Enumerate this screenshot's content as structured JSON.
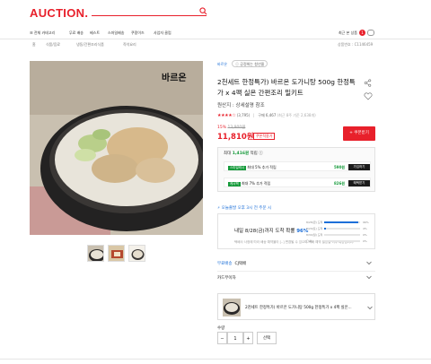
{
  "header": {
    "logo": "AUCTION.",
    "nav": [
      "전체 카테고리",
      "무료 배송",
      "베스트",
      "스마일배송",
      "쿠팡이즈",
      "사업자 클럽"
    ],
    "right_link": "최근 본 상품",
    "cart_count": "1"
  },
  "breadcrumb": [
    "홈",
    "식품/음료",
    "냉동/간편조리식품",
    "즉석요리"
  ],
  "product_no": "상품번호 : C1146459",
  "product": {
    "shop_name": "바르온",
    "shop_tag": "ⓘ 공정위는 청년몰",
    "title": "2천세트 한정특가) 바르온 도가니탕 500g 한정특가 x 4팩 실온 간편조리 밀키트",
    "origin": "원산지 : 상세설명 참조",
    "stars": "★★★★☆",
    "review_count": "(3,795)",
    "purchase": "구매 6,467",
    "purchase_sub": "(최근 8주 기준 2,638개)",
    "discount_rate": "15%",
    "original_price": "13,900원",
    "price": "11,810원",
    "coupon_tag": "쿠폰적용가",
    "coupon_button": "+ 쿠폰받기"
  },
  "benefits": {
    "head_prefix": "최대",
    "head_points": "1,416원",
    "head_suffix": "적립 ⓘ",
    "rows": [
      {
        "badge": "스마일캐시",
        "label": "최대 5% 추가 적립",
        "points": "590원",
        "button": "가입하기"
      },
      {
        "badge": "캐시백",
        "label": "최대 7% 추가 적립",
        "points": "826원",
        "button": "혜택받기"
      }
    ]
  },
  "shipping": {
    "head": "⚡ 오늘출발 오후 3시 전 주문 시",
    "main_prefix": "내일 8/28(금)까지 도착 확률",
    "main_rate": "96%",
    "sub": "택배사 사정에 따라 배송 예약율이 [..] 변경될 수 있으며 택배 예약 발송일 이후 배송됩니다.",
    "bars": [
      {
        "label": "8/28(금) 도착",
        "value": "96%",
        "fraction": 0.96
      },
      {
        "label": "8/29(토) 도착",
        "value": "4%",
        "fraction": 0.04
      },
      {
        "label": "8/30(일) 도착",
        "value": "0%",
        "fraction": 0.0
      },
      {
        "label": "그 외",
        "value": "0%",
        "fraction": 0.0
      }
    ]
  },
  "options": [
    {
      "key": "무료배송",
      "value": "CJ택배"
    },
    {
      "key": "카드무이자",
      "value": ""
    }
  ],
  "selected_item": "2천세트 한정특가) 바르온 도가니탕 500g 한정특가 x 4팩 실온...",
  "quantity": {
    "label": "수량",
    "value": "1",
    "minus": "−",
    "plus": "+",
    "button": "선택"
  },
  "image_brand": "바르온"
}
